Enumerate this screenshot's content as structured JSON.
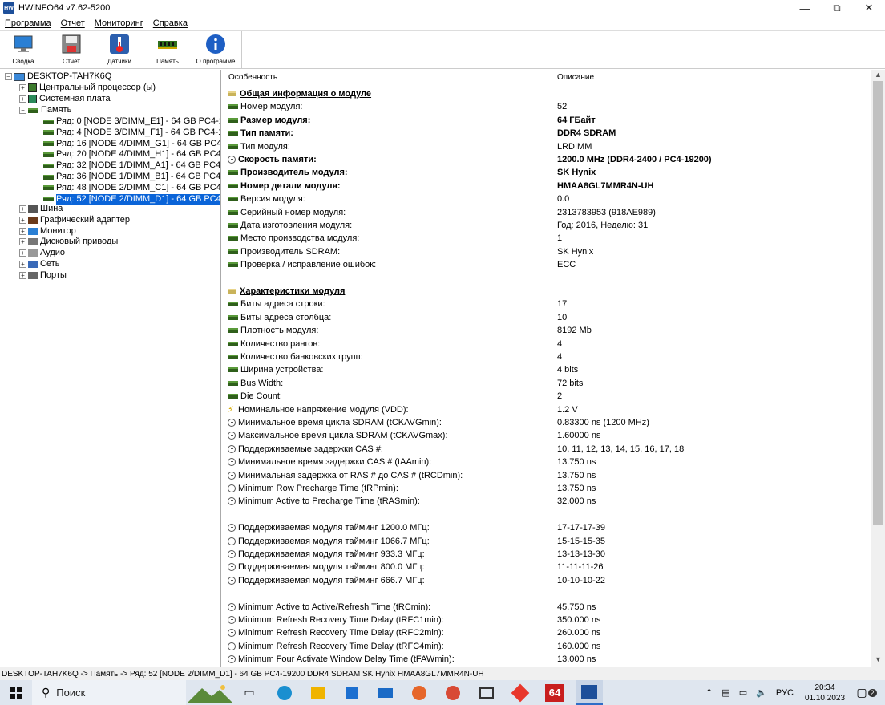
{
  "window": {
    "title": "HWiNFO64 v7.62-5200",
    "app_icon_text": "HW"
  },
  "menu": [
    "Программа",
    "Отчет",
    "Мониторинг",
    "Справка"
  ],
  "toolbar": [
    {
      "label": "Сводка",
      "icon": "monitor-icon"
    },
    {
      "label": "Отчет",
      "icon": "floppy-icon"
    },
    {
      "label": "Датчики",
      "icon": "thermometer-icon"
    },
    {
      "label": "Память",
      "icon": "ram-icon"
    },
    {
      "label": "О программе",
      "icon": "info-icon"
    }
  ],
  "tree": {
    "root": "DESKTOP-TAH7K6Q",
    "top_items": [
      "Центральный процессор (ы)",
      "Системная плата",
      "Память"
    ],
    "memory_children": [
      "Ряд: 0 [NODE 3/DIMM_E1] - 64 GB PC4-19",
      "Ряд: 4 [NODE 3/DIMM_F1] - 64 GB PC4-19",
      "Ряд: 16 [NODE 4/DIMM_G1] - 64 GB PC4-1",
      "Ряд: 20 [NODE 4/DIMM_H1] - 64 GB PC4-1",
      "Ряд: 32 [NODE 1/DIMM_A1] - 64 GB PC4-1",
      "Ряд: 36 [NODE 1/DIMM_B1] - 64 GB PC4-1",
      "Ряд: 48 [NODE 2/DIMM_C1] - 64 GB PC4-1",
      "Ряд: 52 [NODE 2/DIMM_D1] - 64 GB PC4-1"
    ],
    "selected_index": 7,
    "bottom_items": [
      "Шина",
      "Графический адаптер",
      "Монитор",
      "Дисковый приводы",
      "Аудио",
      "Сеть",
      "Порты"
    ]
  },
  "details": {
    "col_feature": "Особенность",
    "col_desc": "Описание",
    "rows": [
      {
        "t": "sec",
        "k": "Общая информация о модуле",
        "v": ""
      },
      {
        "t": "ram",
        "k": "Номер модуля:",
        "v": "52"
      },
      {
        "t": "ram",
        "k": "Размер модуля:",
        "v": "64 ГБайт",
        "b": true
      },
      {
        "t": "ram",
        "k": "Тип памяти:",
        "v": "DDR4 SDRAM",
        "b": true
      },
      {
        "t": "ram",
        "k": "Тип модуля:",
        "v": "LRDIMM"
      },
      {
        "t": "clock",
        "k": "Скорость памяти:",
        "v": "1200.0 MHz (DDR4-2400 / PC4-19200)",
        "b": true
      },
      {
        "t": "ram",
        "k": "Производитель модуля:",
        "v": "SK Hynix",
        "b": true
      },
      {
        "t": "ram",
        "k": "Номер детали модуля:",
        "v": "HMAA8GL7MMR4N-UH",
        "b": true
      },
      {
        "t": "ram",
        "k": "Версия модуля:",
        "v": "0.0"
      },
      {
        "t": "ram",
        "k": "Серийный номер модуля:",
        "v": "2313783953 (918AE989)"
      },
      {
        "t": "ram",
        "k": "Дата изготовления модуля:",
        "v": "Год: 2016, Неделю: 31"
      },
      {
        "t": "ram",
        "k": "Место производства модуля:",
        "v": "1"
      },
      {
        "t": "ram",
        "k": "Производитель SDRAM:",
        "v": "SK Hynix"
      },
      {
        "t": "ram",
        "k": "Проверка / исправление ошибок:",
        "v": "ECC"
      },
      {
        "t": "blank",
        "k": "",
        "v": ""
      },
      {
        "t": "sec",
        "k": "Характеристики модуля",
        "v": ""
      },
      {
        "t": "ram",
        "k": "Биты адреса строки:",
        "v": "17"
      },
      {
        "t": "ram",
        "k": "Биты адреса столбца:",
        "v": "10"
      },
      {
        "t": "ram",
        "k": "Плотность модуля:",
        "v": "8192 Mb"
      },
      {
        "t": "ram",
        "k": "Количество рангов:",
        "v": "4"
      },
      {
        "t": "ram",
        "k": "Количество банковских групп:",
        "v": "4"
      },
      {
        "t": "ram",
        "k": "Ширина устройства:",
        "v": "4 bits"
      },
      {
        "t": "ram",
        "k": "Bus Width:",
        "v": "72 bits"
      },
      {
        "t": "ram",
        "k": "Die Count:",
        "v": "2"
      },
      {
        "t": "bolt",
        "k": "Номинальное напряжение модуля (VDD):",
        "v": "1.2 V"
      },
      {
        "t": "clock",
        "k": "Минимальное время цикла SDRAM (tCKAVGmin):",
        "v": "0.83300 ns (1200 MHz)"
      },
      {
        "t": "clock",
        "k": "Максимальное время цикла SDRAM (tCKAVGmax):",
        "v": "1.60000 ns"
      },
      {
        "t": "clock",
        "k": "Поддерживаемые задержки CAS #:",
        "v": "10, 11, 12, 13, 14, 15, 16, 17, 18"
      },
      {
        "t": "clock",
        "k": "Минимальное время задержки CAS # (tAAmin):",
        "v": "13.750 ns"
      },
      {
        "t": "clock",
        "k": "Минимальная задержка от RAS # до CAS # (tRCDmin):",
        "v": "13.750 ns"
      },
      {
        "t": "clock",
        "k": "Minimum Row Precharge Time (tRPmin):",
        "v": "13.750 ns"
      },
      {
        "t": "clock",
        "k": "Minimum Active to Precharge Time (tRASmin):",
        "v": "32.000 ns"
      },
      {
        "t": "blank",
        "k": "",
        "v": ""
      },
      {
        "t": "clock",
        "k": "Поддерживаемая модуля тайминг 1200.0 МГц:",
        "v": "17-17-17-39"
      },
      {
        "t": "clock",
        "k": "Поддерживаемая модуля тайминг 1066.7 МГц:",
        "v": "15-15-15-35"
      },
      {
        "t": "clock",
        "k": "Поддерживаемая модуля тайминг 933.3 МГц:",
        "v": "13-13-13-30"
      },
      {
        "t": "clock",
        "k": "Поддерживаемая модуля тайминг 800.0 МГц:",
        "v": "11-11-11-26"
      },
      {
        "t": "clock",
        "k": "Поддерживаемая модуля тайминг 666.7 МГц:",
        "v": "10-10-10-22"
      },
      {
        "t": "blank",
        "k": "",
        "v": ""
      },
      {
        "t": "clock",
        "k": "Minimum Active to Active/Refresh Time (tRCmin):",
        "v": "45.750 ns"
      },
      {
        "t": "clock",
        "k": "Minimum Refresh Recovery Time Delay (tRFC1min):",
        "v": "350.000 ns"
      },
      {
        "t": "clock",
        "k": "Minimum Refresh Recovery Time Delay (tRFC2min):",
        "v": "260.000 ns"
      },
      {
        "t": "clock",
        "k": "Minimum Refresh Recovery Time Delay (tRFC4min):",
        "v": "160.000 ns"
      },
      {
        "t": "clock",
        "k": "Minimum Four Activate Window Delay Time (tFAWmin):",
        "v": "13.000 ns"
      }
    ]
  },
  "status": "DESKTOP-TAH7K6Q -> Память -> Ряд: 52 [NODE 2/DIMM_D1] - 64 GB PC4-19200 DDR4 SDRAM SK Hynix HMAA8GL7MMR4N-UH",
  "taskbar": {
    "search_placeholder": "Поиск",
    "lang": "РУС",
    "time": "20:34",
    "date": "01.10.2023",
    "notifications": "2",
    "hw_badge": "64"
  }
}
